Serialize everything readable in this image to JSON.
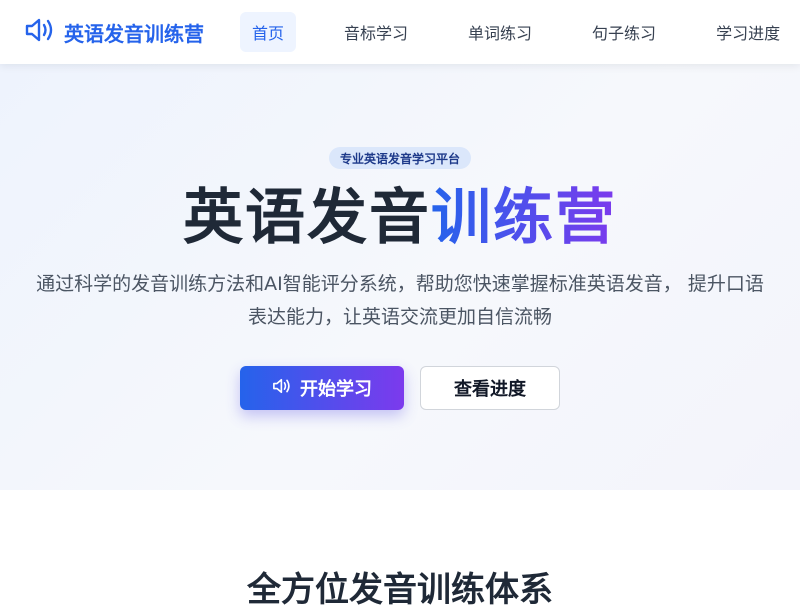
{
  "navbar": {
    "brand": {
      "icon": "speaker-icon",
      "title": "英语发音训练营"
    },
    "items": [
      {
        "label": "首页",
        "active": true
      },
      {
        "label": "音标学习",
        "active": false
      },
      {
        "label": "单词练习",
        "active": false
      },
      {
        "label": "句子练习",
        "active": false
      },
      {
        "label": "学习进度",
        "active": false
      }
    ]
  },
  "hero": {
    "badge": "专业英语发音学习平台",
    "title_plain": "英语发音",
    "title_gradient": "训练营",
    "description_line1": "通过科学的发音训练方法和AI智能评分系统，帮助您快速掌握标准英语发音， 提升口语",
    "description_line2": "表达能力，让英语交流更加自信流畅",
    "primary_button": {
      "icon": "speaker-icon",
      "label": "开始学习"
    },
    "secondary_button": {
      "label": "查看进度"
    }
  },
  "features": {
    "title": "全方位发音训练体系"
  },
  "colors": {
    "accent": "#2563eb",
    "gradient_end": "#7c3aed",
    "active_nav_bg": "#eef4ff"
  }
}
